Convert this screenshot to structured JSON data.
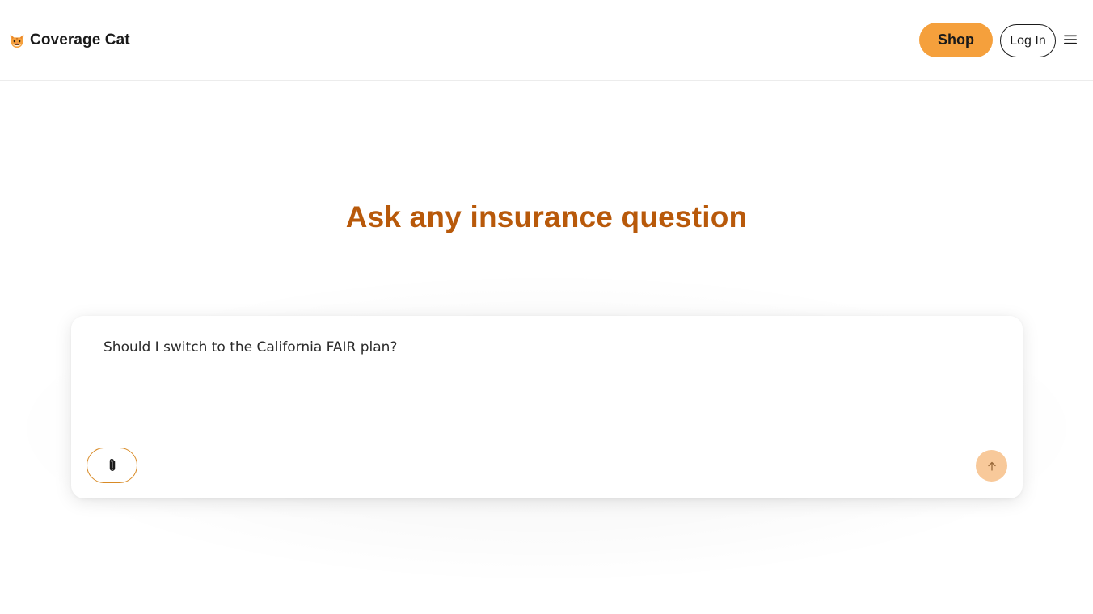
{
  "header": {
    "brand_name": "Coverage Cat",
    "logo_icon": "cat-face-icon",
    "shop_label": "Shop",
    "login_label": "Log In",
    "menu_icon": "hamburger-menu-icon"
  },
  "main": {
    "title": "Ask any insurance question",
    "question_text": "Should I switch to the California FAIR plan?",
    "attach_icon": "paperclip-icon",
    "send_icon": "arrow-up-icon"
  },
  "colors": {
    "accent": "#f5a03c",
    "title": "#b8590a",
    "attach_border": "#d88a25",
    "send_disabled": "#f8c99a"
  }
}
